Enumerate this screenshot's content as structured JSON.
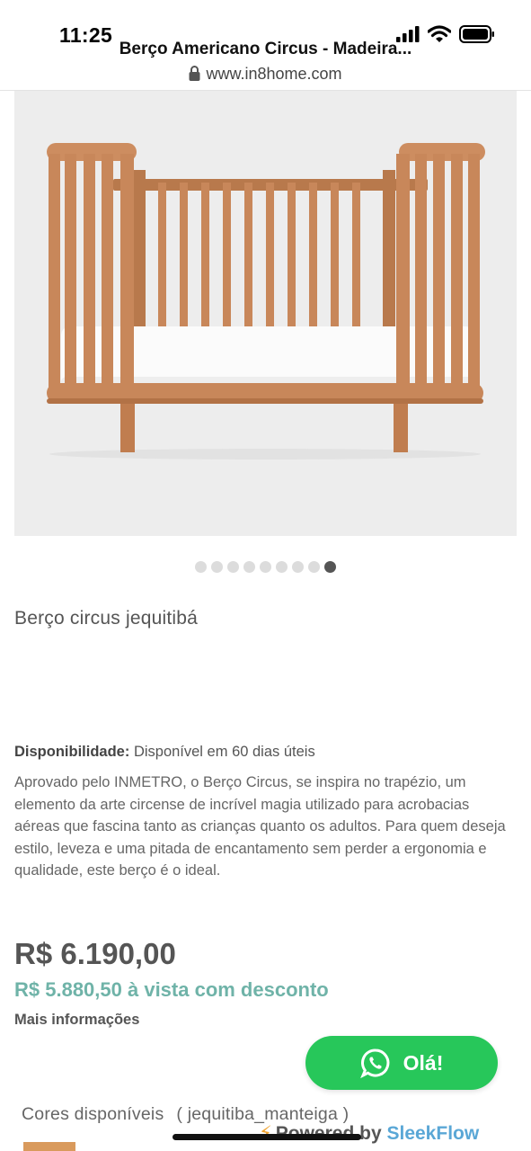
{
  "status_bar": {
    "time": "11:25",
    "icons": [
      "signal-icon",
      "wifi-icon",
      "battery-icon"
    ]
  },
  "browser": {
    "page_title": "Berço Americano Circus - Madeira...",
    "url": "www.in8home.com"
  },
  "gallery": {
    "image_subject": "crib-photo",
    "dot_count": 9,
    "active_index": 8
  },
  "product": {
    "name": "Berço circus jequitibá",
    "availability_label": "Disponibilidade:",
    "availability_value": "Disponível em 60 dias úteis",
    "description": "Aprovado pelo INMETRO, o Berço Circus, se inspira no trapézio, um elemento da arte circense de incrível magia utilizado para acrobacias aéreas que fascina tanto as crianças quanto os adultos. Para quem deseja estilo, leveza e uma pitada de encantamento sem perder a ergonomia e qualidade, este berço é o ideal.",
    "price": "R$ 6.190,00",
    "price_discount": "R$ 5.880,50 à vista com desconto",
    "more_info": "Mais informações",
    "colors_label": "Cores disponíveis",
    "colors_value": "( jequitiba_manteiga )"
  },
  "chat_widget": {
    "button_label": "Olá!",
    "powered_prefix": "Powered",
    "powered_by": "by",
    "powered_brand": "SleekFlow"
  },
  "colors": {
    "discount_price": "#6fb3a8",
    "whatsapp_green": "#27c75a",
    "brand_blue": "#5aa7d6",
    "wood": "#c8875a"
  }
}
